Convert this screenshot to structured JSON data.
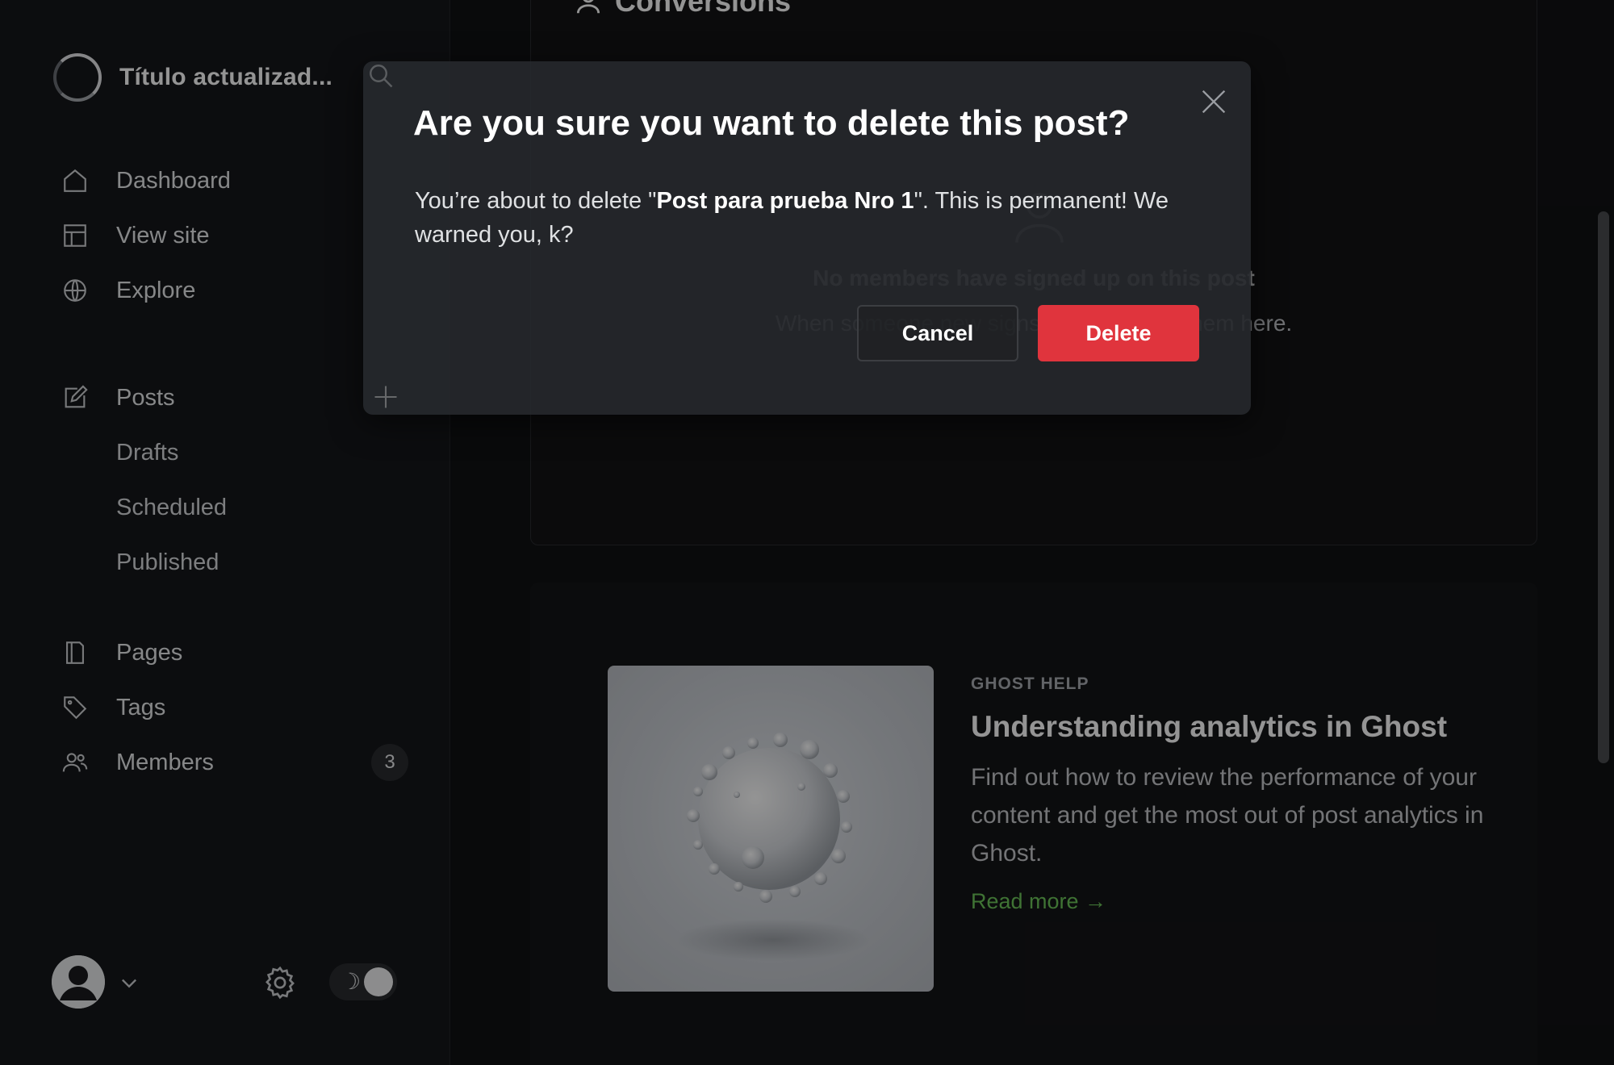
{
  "sidebar": {
    "site_title": "Título actualizad...",
    "nav": [
      {
        "label": "Dashboard",
        "icon": "home-icon"
      },
      {
        "label": "View site",
        "icon": "layout-icon"
      },
      {
        "label": "Explore",
        "icon": "globe-icon"
      }
    ],
    "posts": {
      "label": "Posts",
      "icon": "edit-icon",
      "subitems": [
        "Drafts",
        "Scheduled",
        "Published"
      ]
    },
    "pages_label": "Pages",
    "tags_label": "Tags",
    "members_label": "Members",
    "members_count": "3",
    "toggle_moon": "☽"
  },
  "main": {
    "conversions_title": "Conversions",
    "empty_title": "No members have signed up on this post",
    "empty_sub": "When someone new signs up, you'll see them here.",
    "help": {
      "label": "GHOST HELP",
      "title": "Understanding analytics in Ghost",
      "description": "Find out how to review the performance of your content and get the most out of post analytics in Ghost.",
      "link": "Read more →"
    }
  },
  "modal": {
    "title": "Are you sure you want to delete this post?",
    "body_prefix": "You’re about to delete \"",
    "post_name": "Post para prueba Nro 1",
    "body_suffix": "\". This is permanent! We warned you, k?",
    "cancel_label": "Cancel",
    "delete_label": "Delete"
  },
  "colors": {
    "delete_button": "#e0343d",
    "link_green": "#6dc75a",
    "sidebar_bg": "#15171a"
  }
}
